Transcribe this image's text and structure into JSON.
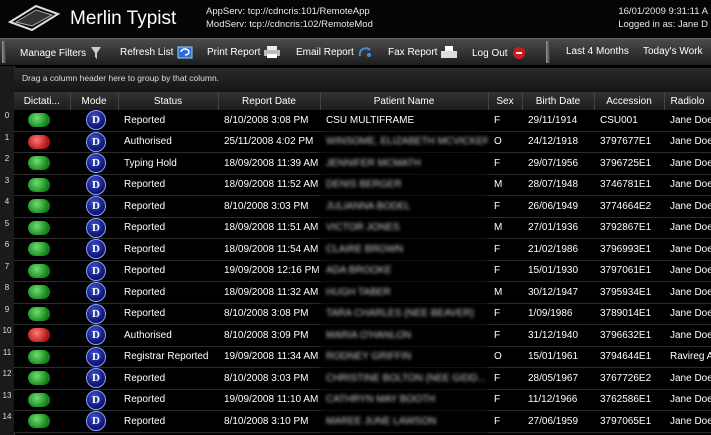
{
  "header": {
    "title": "Merlin Typist",
    "app_server": "AppServ: tcp://cdncris:101/RemoteApp",
    "mod_server": "ModServ: tcp://cdncris:102/RemoteMod",
    "datetime": "16/01/2009 9:31:11 A",
    "logged_in": "Logged in as: Jane D"
  },
  "toolbar": {
    "manage_filters": "Manage Filters",
    "refresh_list": "Refresh List",
    "print_report": "Print Report",
    "email_report": "Email Report",
    "fax_report": "Fax Report",
    "log_out": "Log Out",
    "last_4_months": "Last 4 Months",
    "todays_work": "Today's Work"
  },
  "group_hint": "Drag a column header here to group by that column.",
  "columns": [
    "Dictati...",
    "Mode",
    "Status",
    "Report Date",
    "Patient Name",
    "Sex",
    "Birth Date",
    "Accession",
    "Radiolo"
  ],
  "mode_letter": "D",
  "rows": [
    {
      "num": "0",
      "dict": "green",
      "status": "Reported",
      "date": "8/10/2008 3:08 PM",
      "patient": "CSU MULTIFRAME",
      "sex": "F",
      "birth": "29/11/1914",
      "acc": "CSU001",
      "rad": "Jane Doe"
    },
    {
      "num": "1",
      "dict": "red",
      "status": "Authorised",
      "date": "25/11/2008 4:02 PM",
      "patient": "WINSOME, ELIZABETH MCVICKER",
      "sex": "O",
      "birth": "24/12/1918",
      "acc": "3797677E1",
      "rad": "Jane Doe"
    },
    {
      "num": "2",
      "dict": "green",
      "status": "Typing Hold",
      "date": "18/09/2008 11:39 AM",
      "patient": "JENNIFER MCMATH",
      "sex": "F",
      "birth": "29/07/1956",
      "acc": "3796725E1",
      "rad": "Jane Doe"
    },
    {
      "num": "3",
      "dict": "green",
      "status": "Reported",
      "date": "18/09/2008 11:52 AM",
      "patient": "DENIS BERGER",
      "sex": "M",
      "birth": "28/07/1948",
      "acc": "3746781E1",
      "rad": "Jane Doe"
    },
    {
      "num": "4",
      "dict": "green",
      "status": "Reported",
      "date": "8/10/2008 3:03 PM",
      "patient": "JULIANNA BODEL",
      "sex": "F",
      "birth": "26/06/1949",
      "acc": "3774664E2",
      "rad": "Jane Doe"
    },
    {
      "num": "5",
      "dict": "green",
      "status": "Reported",
      "date": "18/09/2008 11:51 AM",
      "patient": "VICTOR JONES",
      "sex": "M",
      "birth": "27/01/1936",
      "acc": "3792867E1",
      "rad": "Jane Doe"
    },
    {
      "num": "6",
      "dict": "green",
      "status": "Reported",
      "date": "18/09/2008 11:54 AM",
      "patient": "CLAIRE BROWN",
      "sex": "F",
      "birth": "21/02/1986",
      "acc": "3796993E1",
      "rad": "Jane Doe"
    },
    {
      "num": "7",
      "dict": "green",
      "status": "Reported",
      "date": "19/09/2008 12:16 PM",
      "patient": "ADA BROOKE",
      "sex": "F",
      "birth": "15/01/1930",
      "acc": "3797061E1",
      "rad": "Jane Doe"
    },
    {
      "num": "8",
      "dict": "green",
      "status": "Reported",
      "date": "18/09/2008 11:32 AM",
      "patient": "HUGH TABER",
      "sex": "M",
      "birth": "30/12/1947",
      "acc": "3795934E1",
      "rad": "Jane Doe"
    },
    {
      "num": "9",
      "dict": "green",
      "status": "Reported",
      "date": "8/10/2008 3:08 PM",
      "patient": "TARA CHARLES (NEE BEAVER)",
      "sex": "F",
      "birth": "1/09/1986",
      "acc": "3789014E1",
      "rad": "Jane Doe"
    },
    {
      "num": "10",
      "dict": "red",
      "status": "Authorised",
      "date": "8/10/2008 3:09 PM",
      "patient": "MARIA O'HANLON",
      "sex": "F",
      "birth": "31/12/1940",
      "acc": "3796632E1",
      "rad": "Jane Doe"
    },
    {
      "num": "11",
      "dict": "green",
      "status": "Registrar Reported",
      "date": "19/09/2008 11:34 AM",
      "patient": "RODNEY GRIFFIN",
      "sex": "O",
      "birth": "15/01/1961",
      "acc": "3794644E1",
      "rad": "Ravireg Ab"
    },
    {
      "num": "12",
      "dict": "green",
      "status": "Reported",
      "date": "8/10/2008 3:03 PM",
      "patient": "CHRISTINE BOLTON (NEE GIDD...",
      "sex": "F",
      "birth": "28/05/1967",
      "acc": "3767726E2",
      "rad": "Jane Doe"
    },
    {
      "num": "13",
      "dict": "green",
      "status": "Reported",
      "date": "19/09/2008 11:10 AM",
      "patient": "CATHRYN MAY BOOTH",
      "sex": "F",
      "birth": "11/12/1966",
      "acc": "3762586E1",
      "rad": "Jane Doe"
    },
    {
      "num": "14",
      "dict": "green",
      "status": "Reported",
      "date": "8/10/2008 3:10 PM",
      "patient": "MAREE JUNE LAWSON",
      "sex": "F",
      "birth": "27/06/1959",
      "acc": "3797065E1",
      "rad": "Jane Doe"
    }
  ]
}
